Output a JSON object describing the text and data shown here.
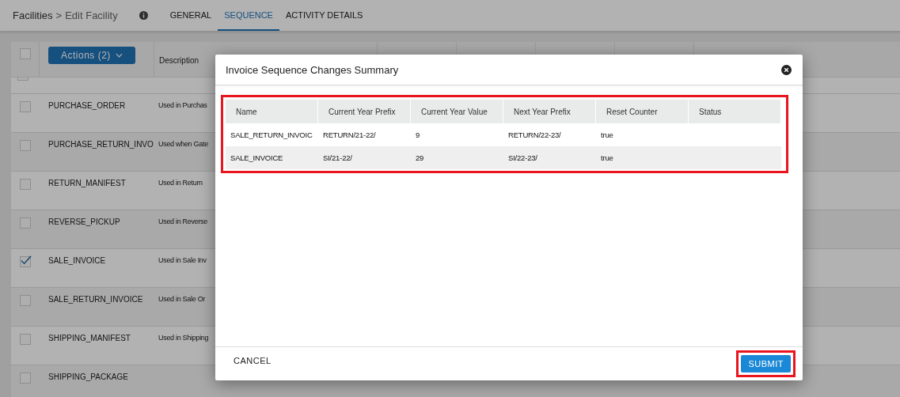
{
  "breadcrumb": {
    "parent": "Facilities",
    "separator": ">",
    "current": "Edit Facility"
  },
  "tabs": [
    {
      "label": "GENERAL",
      "selected": false
    },
    {
      "label": "SEQUENCE",
      "selected": true
    },
    {
      "label": "ACTIVITY DETAILS",
      "selected": false
    }
  ],
  "sequence_table": {
    "actions_button": "Actions (2)",
    "header_checked": false,
    "description_header": "Description",
    "rows": [
      {
        "name": "PURCHASE_ORDER",
        "description": "Used in Purchas",
        "checked": false
      },
      {
        "name": "PURCHASE_RETURN_INVO",
        "description": "Used when Gate",
        "checked": false
      },
      {
        "name": "RETURN_MANIFEST",
        "description": "Used in Return",
        "checked": false
      },
      {
        "name": "REVERSE_PICKUP",
        "description": "Used in Reverse",
        "checked": false
      },
      {
        "name": "SALE_INVOICE",
        "description": "Used in Sale Inv",
        "checked": true
      },
      {
        "name": "SALE_RETURN_INVOICE",
        "description": "Used in Sale Or",
        "checked": false
      },
      {
        "name": "SHIPPING_MANIFEST",
        "description": "Used in Shipping",
        "checked": false
      },
      {
        "name": "SHIPPING_PACKAGE",
        "checked": false
      }
    ]
  },
  "dialog": {
    "title": "Invoice Sequence Changes Summary",
    "columns": [
      "Name",
      "Current Year Prefix",
      "Current Year Value",
      "Next Year Prefix",
      "Reset Counter",
      "Status"
    ],
    "rows": [
      [
        "SALE_RETURN_INVOIC",
        "RETURN/21-22/",
        "9",
        "RETURN/22-23/",
        "true"
      ],
      [
        "SALE_INVOICE",
        "SI/21-22/",
        "29",
        "SI/22-23/",
        "true"
      ]
    ],
    "cancel": "CANCEL",
    "submit": "SUBMIT"
  }
}
